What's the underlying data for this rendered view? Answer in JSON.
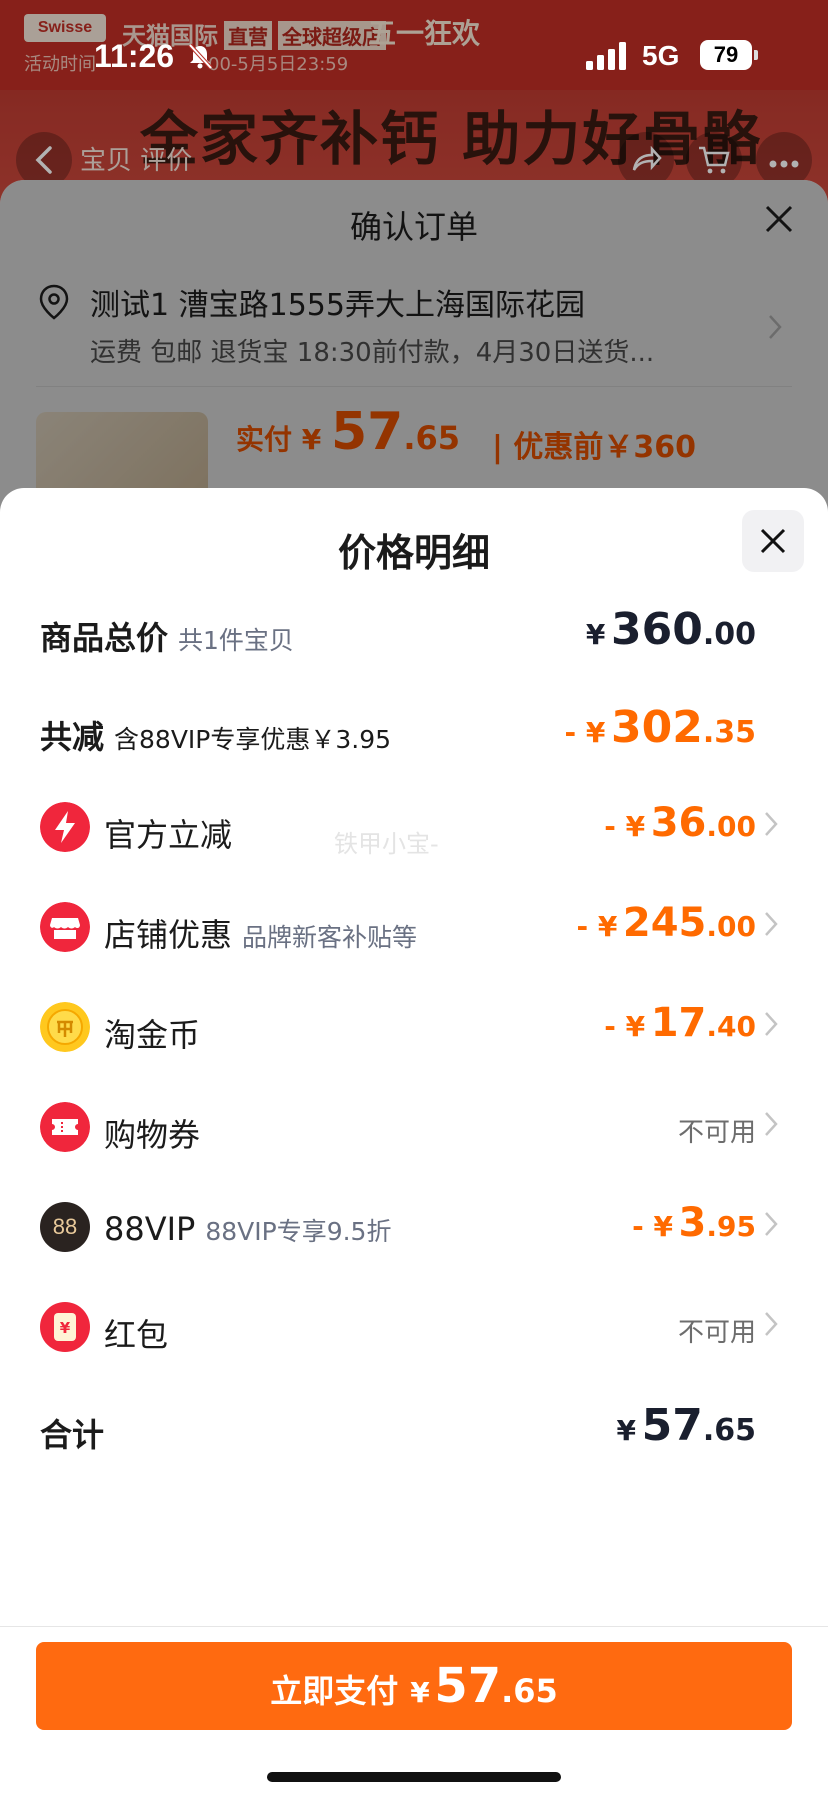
{
  "status_bar": {
    "time": "11:26",
    "network": "5G",
    "battery": "79"
  },
  "background_page": {
    "logo": "Swisse",
    "store": "天猫国际",
    "store_tag": "直营",
    "store_badge": "全球超级店",
    "festival": "五一狂欢",
    "activity": "活动时间",
    "activity_end": "00-5月5日23:59",
    "headline": "全家齐补钙 助力好骨骼",
    "tabs": "宝贝  评价"
  },
  "confirm_order": {
    "title": "确认订单",
    "address_line": "测试1 漕宝路1555弄大上海国际花园",
    "shipping_line": "运费 包邮 退货宝 18:30前付款，4月30日送货...",
    "paid_label": "实付",
    "paid_currency": "¥",
    "paid_int": "57",
    "paid_dec": ".65",
    "before_discount": "| 优惠前￥360"
  },
  "price_detail": {
    "title": "价格明细",
    "watermark": "铁甲小宝-",
    "rows": [
      {
        "label": "商品总价",
        "sub": "共1件宝贝",
        "currency": "¥",
        "int": "360",
        "dec": ".00"
      },
      {
        "label": "共减",
        "sub": "含88VIP专享优惠￥3.95",
        "currency": "- ¥",
        "int": "302",
        "dec": ".35"
      },
      {
        "label": "官方立减",
        "sub": "",
        "currency": "- ¥",
        "int": "36",
        "dec": ".00"
      },
      {
        "label": "店铺优惠",
        "sub": "品牌新客补贴等",
        "currency": "- ¥",
        "int": "245",
        "dec": ".00"
      },
      {
        "label": "淘金币",
        "sub": "",
        "currency": "- ¥",
        "int": "17",
        "dec": ".40"
      },
      {
        "label": "购物券",
        "sub": "",
        "status": "不可用"
      },
      {
        "label": "88VIP",
        "sub": "88VIP专享9.5折",
        "currency": "- ¥",
        "int": "3",
        "dec": ".95",
        "icon_text": "88"
      },
      {
        "label": "红包",
        "sub": "",
        "status": "不可用",
        "icon_text": "¥"
      },
      {
        "label": "合计",
        "sub": "",
        "currency": "¥",
        "int": "57",
        "dec": ".65"
      }
    ]
  },
  "pay_button": {
    "label": "立即支付",
    "currency": "¥",
    "int": "57",
    "dec": ".65"
  },
  "colors": {
    "accent": "#ff6a10",
    "discount": "#ff6a00",
    "icon_red": "#f0263c",
    "coin_gold": "#ffc81e",
    "vip_dark": "#2a2320"
  }
}
